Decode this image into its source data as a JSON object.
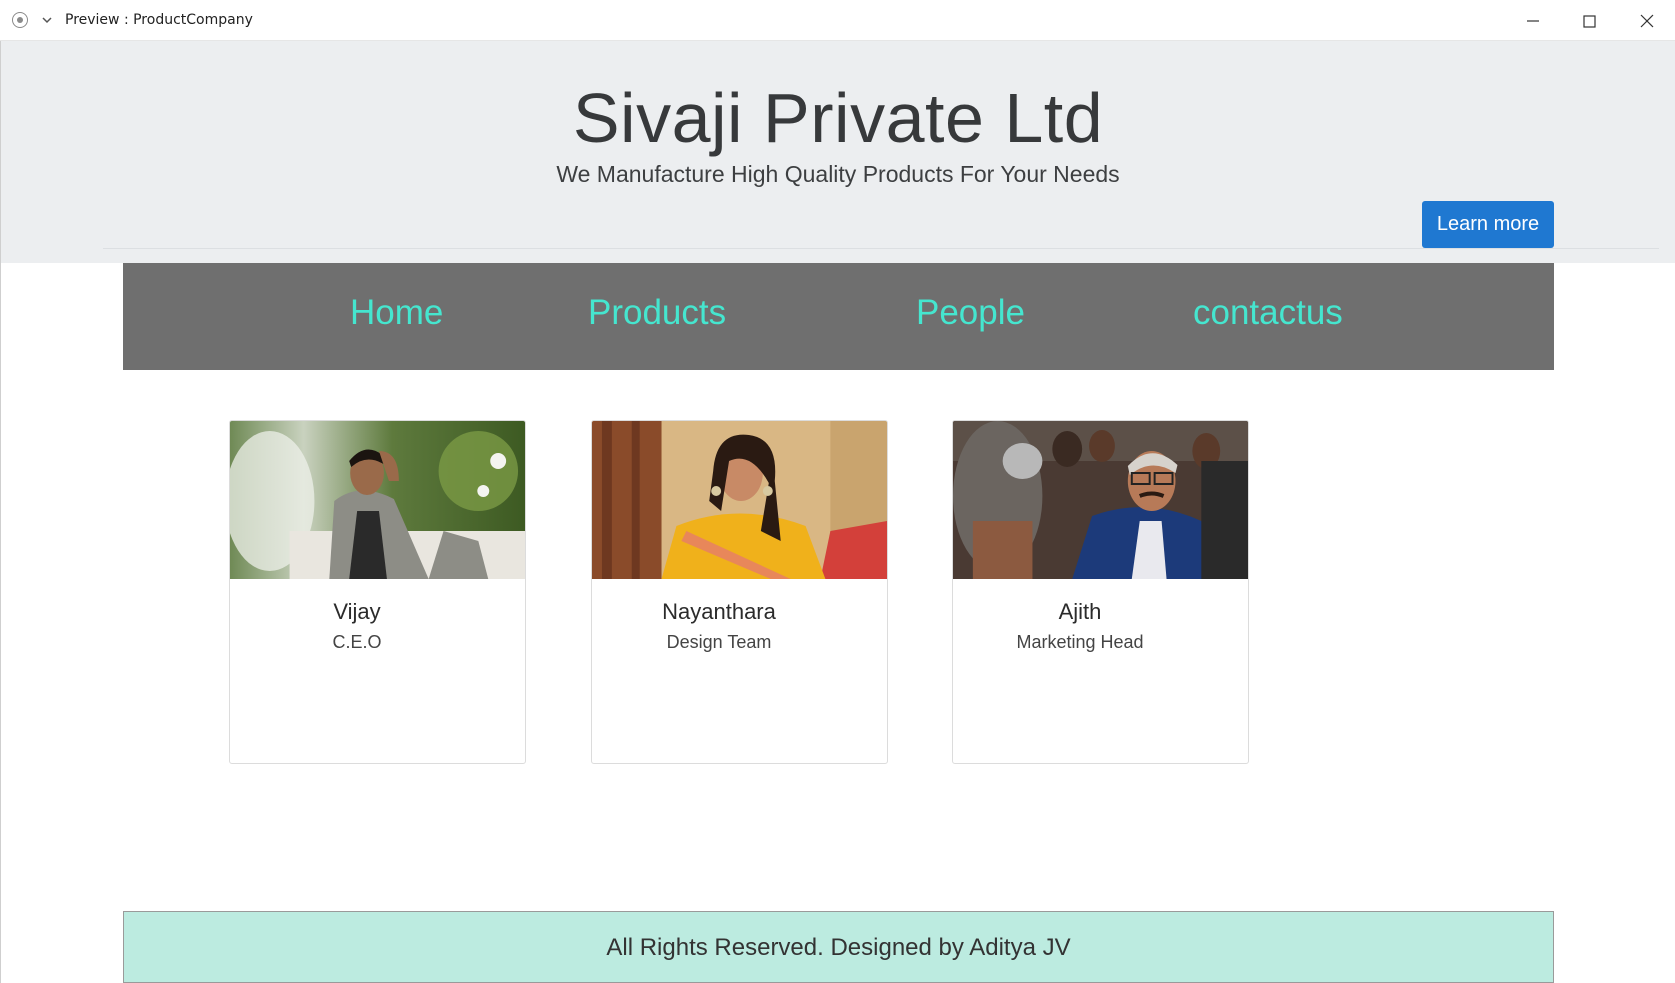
{
  "window": {
    "title": "Preview : ProductCompany"
  },
  "header": {
    "title": "Sivaji Private Ltd",
    "subtitle": "We Manufacture High Quality Products For Your Needs",
    "button_label": "Learn more"
  },
  "nav": {
    "items": [
      {
        "label": "Home"
      },
      {
        "label": "Products"
      },
      {
        "label": "People"
      },
      {
        "label": "contactus"
      }
    ],
    "link_color": "#45e6cf",
    "background": "#6f6f6f"
  },
  "people": [
    {
      "name": "Vijay",
      "role": "C.E.O"
    },
    {
      "name": "Nayanthara",
      "role": "Design Team"
    },
    {
      "name": "Ajith",
      "role": "Marketing Head"
    }
  ],
  "footer": {
    "text": "All Rights Reserved. Designed by Aditya JV",
    "background": "#bcebe0"
  },
  "colors": {
    "accent_button": "#1f78d1",
    "jumbotron_bg": "#eceef0"
  }
}
